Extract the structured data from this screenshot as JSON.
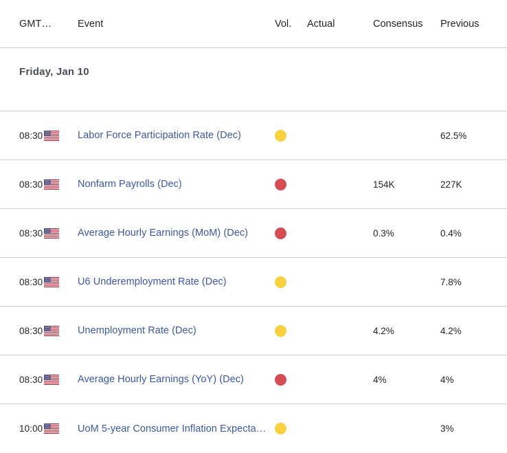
{
  "header": {
    "time_label": "GMT…",
    "event_label": "Event",
    "vol_label": "Vol.",
    "actual_label": "Actual",
    "consensus_label": "Consensus",
    "previous_label": "Previous"
  },
  "date_group": {
    "label": "Friday, Jan 10"
  },
  "colors": {
    "link": "#3a57b0",
    "vol_high": "#d74b52",
    "vol_medium": "#f9d13f",
    "divider": "#c9ced3",
    "text": "#22242a",
    "date_text": "#4a4f57"
  },
  "events": [
    {
      "time": "08:30",
      "country": "United States",
      "flag_icon": "us-flag-icon",
      "event": "Labor Force Participation Rate (Dec)",
      "volatility": "medium",
      "actual": "",
      "consensus": "",
      "previous": "62.5%"
    },
    {
      "time": "08:30",
      "country": "United States",
      "flag_icon": "us-flag-icon",
      "event": "Nonfarm Payrolls (Dec)",
      "volatility": "high",
      "actual": "",
      "consensus": "154K",
      "previous": "227K"
    },
    {
      "time": "08:30",
      "country": "United States",
      "flag_icon": "us-flag-icon",
      "event": "Average Hourly Earnings (MoM) (Dec)",
      "volatility": "high",
      "actual": "",
      "consensus": "0.3%",
      "previous": "0.4%"
    },
    {
      "time": "08:30",
      "country": "United States",
      "flag_icon": "us-flag-icon",
      "event": "U6 Underemployment Rate (Dec)",
      "volatility": "medium",
      "actual": "",
      "consensus": "",
      "previous": "7.8%"
    },
    {
      "time": "08:30",
      "country": "United States",
      "flag_icon": "us-flag-icon",
      "event": "Unemployment Rate (Dec)",
      "volatility": "medium",
      "actual": "",
      "consensus": "4.2%",
      "previous": "4.2%"
    },
    {
      "time": "08:30",
      "country": "United States",
      "flag_icon": "us-flag-icon",
      "event": "Average Hourly Earnings (YoY) (Dec)",
      "volatility": "high",
      "actual": "",
      "consensus": "4%",
      "previous": "4%"
    },
    {
      "time": "10:00",
      "country": "United States",
      "flag_icon": "us-flag-icon",
      "event": "UoM 5-year Consumer Inflation Expecta…",
      "volatility": "medium",
      "actual": "",
      "consensus": "",
      "previous": "3%"
    }
  ]
}
